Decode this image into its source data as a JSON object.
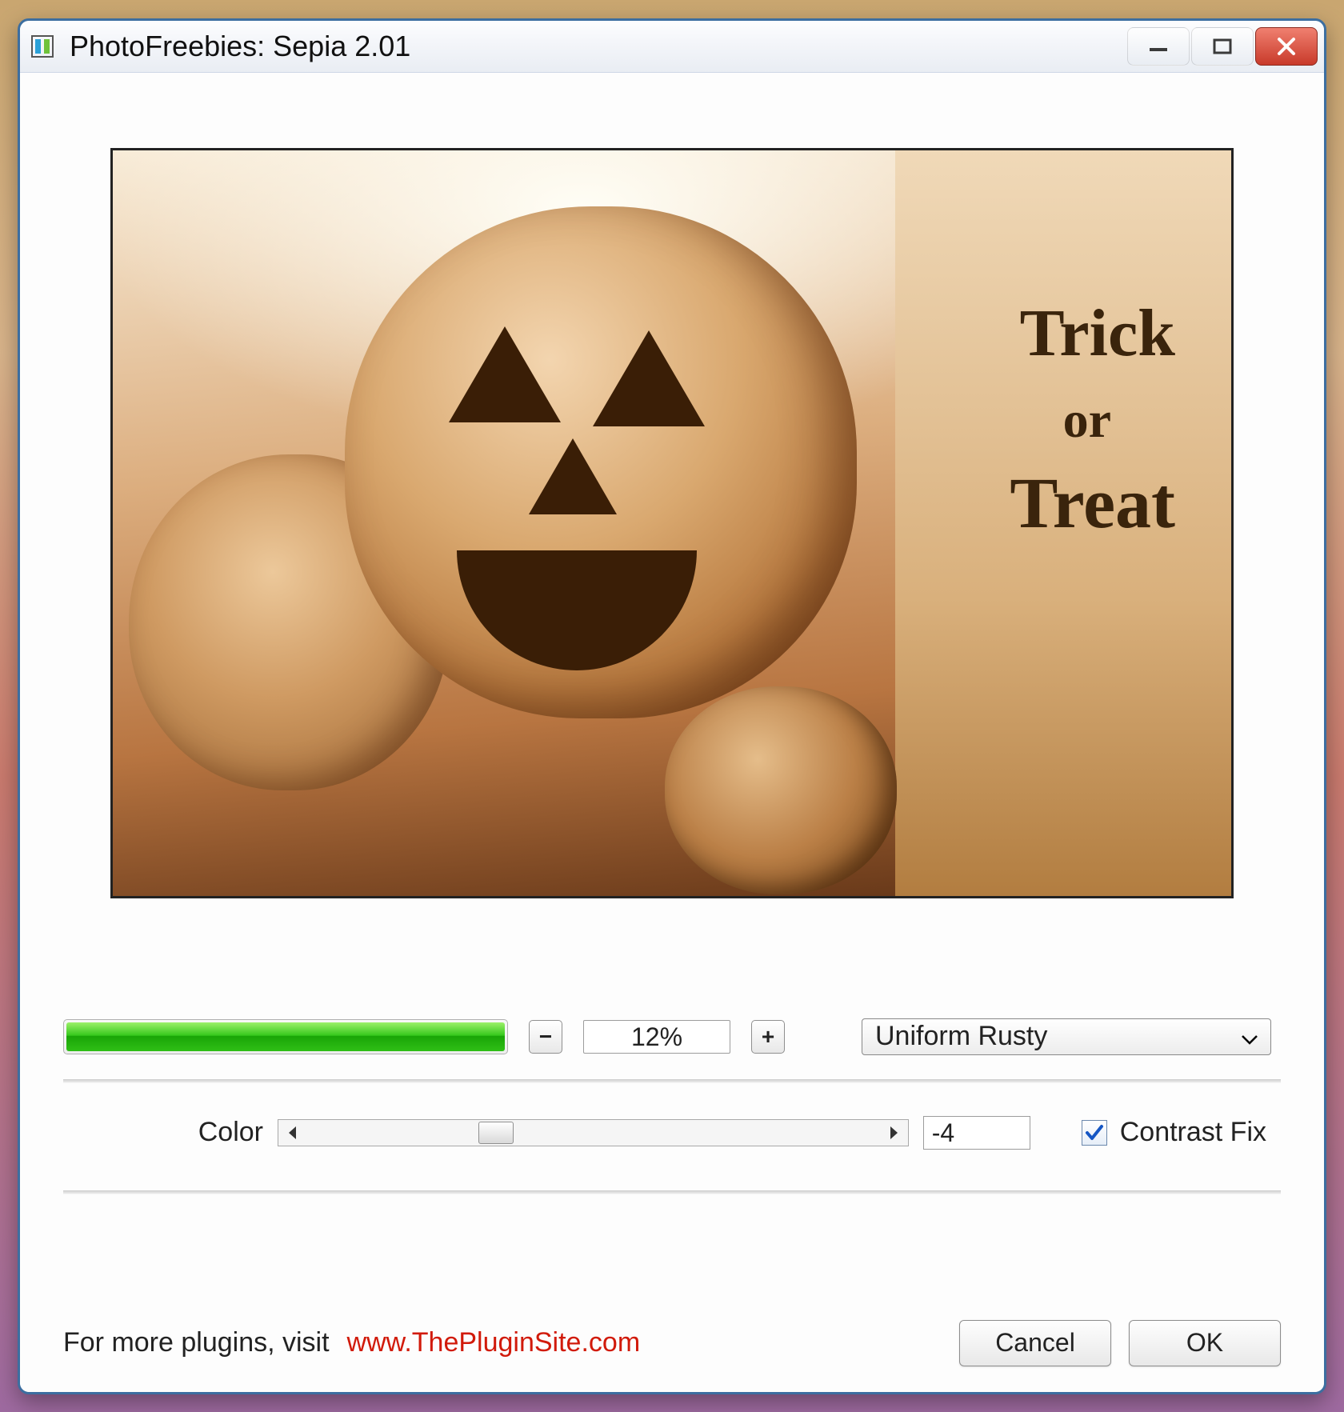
{
  "window": {
    "title": "PhotoFreebies: Sepia 2.01"
  },
  "preview": {
    "bag_text_1": "Trick",
    "bag_text_2": "or",
    "bag_text_3": "Treat"
  },
  "progress": {
    "percent_value": "12%"
  },
  "stepper": {
    "decrement": "−",
    "increment": "+"
  },
  "preset": {
    "selected": "Uniform Rusty"
  },
  "color": {
    "label": "Color",
    "value": "-4"
  },
  "contrast_fix": {
    "label": "Contrast Fix",
    "checked": true
  },
  "footer": {
    "prefix": "For more plugins, visit ",
    "link": "www.ThePluginSite.com",
    "cancel": "Cancel",
    "ok": "OK"
  }
}
